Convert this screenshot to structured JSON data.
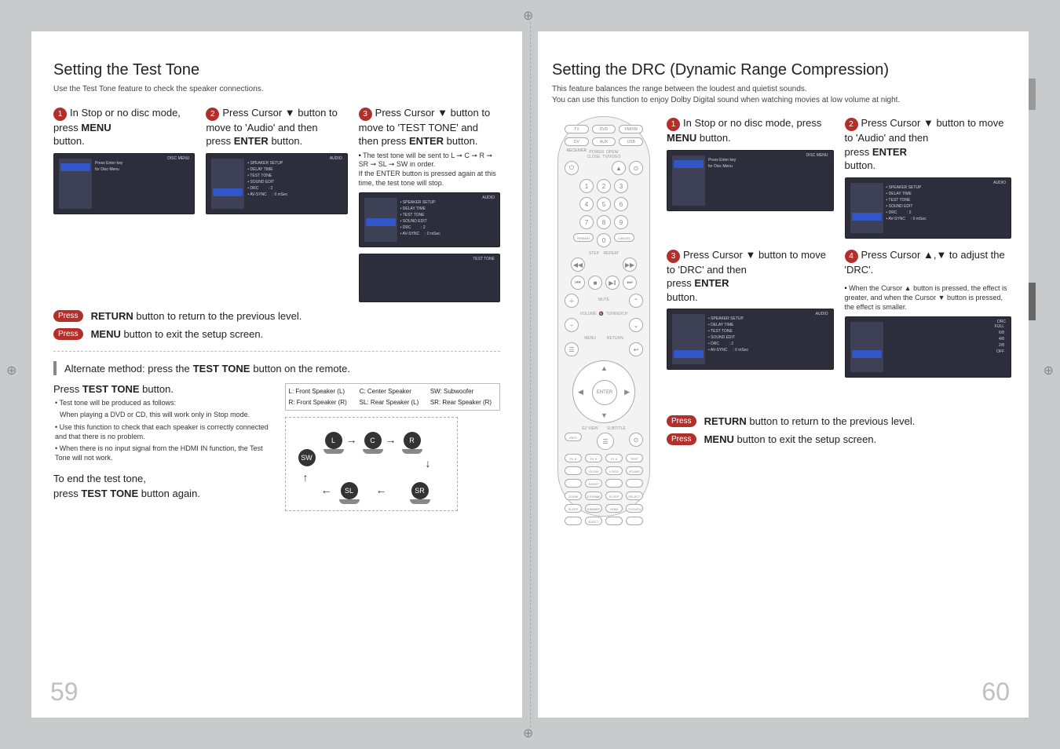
{
  "leftPage": {
    "title": "Setting the Test Tone",
    "intro": "Use the Test Tone feature to check the speaker connections.",
    "steps": [
      {
        "num": "1",
        "line1": "In Stop or no disc mode,",
        "line2": "press",
        "btn": "MENU",
        "line3": "button."
      },
      {
        "num": "2",
        "line1": "Press Cursor ▼ button to move to 'Audio' and then",
        "line2": "press",
        "btn": "ENTER",
        "line3": "button."
      },
      {
        "num": "3",
        "line1": "Press Cursor ▼ button to move to 'TEST TONE' and then press",
        "btn": "ENTER",
        "line2": "button."
      }
    ],
    "step3note": "The test tone will be sent to L ➞ C ➞ R ➞ SR ➞ SL ➞ SW in order.\nIf the ENTER button is pressed again at this time, the test tone will stop.",
    "returnBtn": "RETURN",
    "returnText": " button to return to the previous level.",
    "menuBtn": "MENU",
    "menuText": " button to exit the setup screen.",
    "press": "Press ",
    "altBar1": "Alternate method: press the ",
    "altBtn": "TEST TONE",
    "altBar2": " button on the remote.",
    "altHead": "Press ",
    "altHeadBtn": "TEST TONE",
    "altHead2": " button.",
    "altBul": [
      "Test tone will be produced as follows:",
      "When playing a DVD or CD, this will work only in Stop mode.",
      "Use this function to check that each speaker is correctly connected and that there is no problem.",
      "When there is no input signal from the HDMI IN function, the Test Tone will not work."
    ],
    "endHead": "To end the test tone,",
    "endText1": "press ",
    "endBtn": "TEST TONE",
    "endText2": " button again.",
    "speakerKey": {
      "L": "L: Front Speaker (L)",
      "C": "C: Center Speaker",
      "SW": "SW: Subwoofer",
      "R": "R: Front Speaker (R)",
      "SL": "SL: Rear Speaker (L)",
      "SR": "SR: Rear Speaker (R)"
    },
    "flowLabels": {
      "L": "L",
      "C": "C",
      "R": "R",
      "SW": "SW",
      "SL": "SL",
      "SR": "SR"
    },
    "pageNum": "59",
    "screen1": {
      "title": "DISC MENU",
      "hl": "Disc Menu",
      "items": "Press Enter key\nfor Disc Menu"
    },
    "screen2": {
      "title": "AUDIO",
      "items": "• SPEAKER SETUP\n• DELAY TIME\n• TEST TONE\n• SOUND EDIT\n• DRC         : 2\n• AV-SYNC     : 0 mSec"
    },
    "screen3": {
      "title": "AUDIO",
      "items": "• SPEAKER SETUP\n• DELAY TIME\n• TEST TONE\n• SOUND EDIT\n• DRC         : 2\n• AV-SYNC     : 0 mSec",
      "hlTop": 26
    },
    "screen4": {
      "title": "TEST TONE"
    }
  },
  "rightPage": {
    "title": "Setting the DRC (Dynamic Range Compression)",
    "intro1": "This feature balances the range between the loudest and quietist sounds.",
    "intro2": "You can use this function to enjoy Dolby Digital sound when watching movies at low volume at night.",
    "steps": [
      {
        "num": "1",
        "line1": "In Stop or no disc mode, press",
        "btn": "MENU",
        "line2": "button."
      },
      {
        "num": "2",
        "line1": "Press Cursor ▼ button to move to 'Audio' and then",
        "line2": "press",
        "btn": "ENTER",
        "line3": "button."
      },
      {
        "num": "3",
        "line1": "Press Cursor ▼ button to move to 'DRC' and then",
        "line2": "press",
        "btn": "ENTER",
        "line3": "button."
      },
      {
        "num": "4",
        "line1": "Press Cursor ▲,▼ to adjust the 'DRC'."
      }
    ],
    "step4note": "When the Cursor ▲ button is pressed, the effect is greater, and when the Cursor ▼ button is pressed, the effect is smaller.",
    "press": "Press ",
    "returnBtn": "RETURN",
    "returnText": " button to return to the previous level.",
    "menuBtn": "MENU",
    "menuText": " button to exit the setup screen.",
    "pageNum": "60",
    "screen1": {
      "title": "DISC MENU",
      "items": "Press Enter key\nfor Disc Menu"
    },
    "screen2": {
      "title": "AUDIO",
      "items": "• SPEAKER SETUP\n• DELAY TIME\n• TEST TONE\n• SOUND EDIT\n• DRC         : 2\n• AV-SYNC     : 0 mSec"
    },
    "screen3": {
      "title": "AUDIO",
      "items": "• SPEAKER SETUP\n• DELAY TIME\n• TEST TONE\n• SOUND EDIT\n• DRC         : 2\n• AV-SYNC     : 0 mSec",
      "hlTop": 46
    },
    "screen4": {
      "title": "DRC",
      "items": "FULL\n6/8\n4/8\n2/8\nOFF"
    },
    "remote": {
      "row1": [
        "TV",
        "DVD",
        "FM/XM"
      ],
      "row2": [
        "DV RECEIVER",
        "AUX",
        "USB"
      ],
      "power": "POWER",
      "open": "OPEN/\nCLOSE",
      "tvvid": "TV/VIDEO",
      "nums": [
        "1",
        "2",
        "3",
        "4",
        "5",
        "6",
        "7",
        "8",
        "9",
        "0"
      ],
      "remain": "REMAIN",
      "cancel": "CANCEL",
      "step": "STEP",
      "repeat": "REPEAT",
      "mute": "MUTE",
      "volume": "VOLUME",
      "tuning": "TUNING/CH",
      "menu": "MENU",
      "return": "RETURN",
      "enter": "ENTER",
      "ezview": "EZ VIEW",
      "subtitle": "SUBTITLE",
      "info": "INFO",
      "row3": [
        "PL II\nMODE",
        "PL II\nEFFECT",
        "PL II\nDSP/EQ",
        "TEST TONE"
      ],
      "row4": [
        "SLOW",
        "LOGO",
        "SOUND EDIT"
      ],
      "row5": [
        "NIGHT",
        "",
        ""
      ],
      "row6": [
        "ZOOM",
        "S.FRAME",
        "SLEEP MODE",
        "SELECT"
      ],
      "row7": [
        "SLEEP",
        "DIMMER",
        "HDMI AUDIO",
        "TV/CATV"
      ],
      "row8": [
        "",
        "EJECT",
        "",
        ""
      ]
    }
  }
}
